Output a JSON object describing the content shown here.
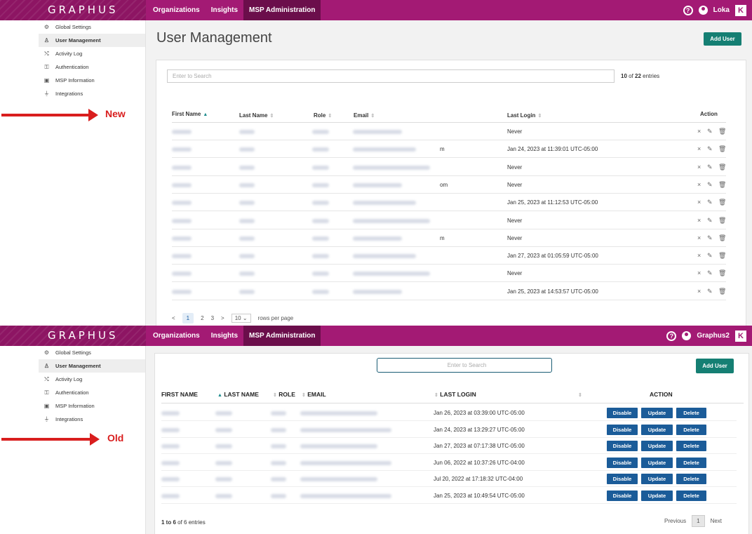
{
  "new": {
    "nav": [
      "Organizations",
      "Insights",
      "MSP Administration"
    ],
    "user_name": "Loka",
    "sidebar": [
      {
        "label": "Global Settings",
        "icon": "gear-icon",
        "glyph": "⚙"
      },
      {
        "label": "User Management",
        "icon": "user-icon",
        "glyph": "♙"
      },
      {
        "label": "Activity Log",
        "icon": "shuffle-icon",
        "glyph": "⤭"
      },
      {
        "label": "Authentication",
        "icon": "user-lock-icon",
        "glyph": "⚿"
      },
      {
        "label": "MSP Information",
        "icon": "id-card-icon",
        "glyph": "▣"
      },
      {
        "label": "Integrations",
        "icon": "plug-icon",
        "glyph": "⏚"
      }
    ],
    "annotation": "New",
    "page_title": "User Management",
    "add_user": "Add User",
    "search_placeholder": "Enter to Search",
    "entries": "10 of 22 entries",
    "columns": [
      "First Name",
      "Last Name",
      "Role",
      "Email",
      "Last Login",
      "Action"
    ],
    "last_logins": [
      "Never",
      "Jan 24, 2023 at 11:39:01 UTC-05:00",
      "Never",
      "Never",
      "Jan 25, 2023 at 11:12:53 UTC-05:00",
      "Never",
      "Never",
      "Jan 27, 2023 at 01:05:59 UTC-05:00",
      "Never",
      "Jan 25, 2023 at 14:53:57 UTC-05:00"
    ],
    "email_visible_suffix": [
      "",
      "m",
      "",
      "om",
      "",
      "",
      "m",
      "",
      "",
      ""
    ],
    "pagination": {
      "pages": [
        "1",
        "2",
        "3"
      ],
      "rows_per_page": "10",
      "rows_label": "rows per page"
    }
  },
  "old": {
    "nav": [
      "Organizations",
      "Insights",
      "MSP Administration"
    ],
    "user_name": "Graphus2",
    "sidebar": [
      {
        "label": "Global Settings",
        "icon": "gear-icon",
        "glyph": "⚙"
      },
      {
        "label": "User Management",
        "icon": "user-icon",
        "glyph": "♙"
      },
      {
        "label": "Activity Log",
        "icon": "shuffle-icon",
        "glyph": "⤭"
      },
      {
        "label": "Authentication",
        "icon": "user-lock-icon",
        "glyph": "⚿"
      },
      {
        "label": "MSP Information",
        "icon": "id-card-icon",
        "glyph": "▣"
      },
      {
        "label": "Integrations",
        "icon": "plug-icon",
        "glyph": "⏚"
      }
    ],
    "annotation": "Old",
    "search_placeholder": "Enter to Search",
    "add_user": "Add User",
    "columns": [
      "FIRST NAME",
      "LAST NAME",
      "ROLE",
      "EMAIL",
      "LAST LOGIN",
      "ACTION"
    ],
    "last_logins": [
      "Jan 26, 2023 at 03:39:00 UTC-05:00",
      "Jan 24, 2023 at 13:29:27 UTC-05:00",
      "Jan 27, 2023 at 07:17:38 UTC-05:00",
      "Jun 06, 2022 at 10:37:26 UTC-04:00",
      "Jul 20, 2022 at 17:18:32 UTC-04:00",
      "Jan 25, 2023 at 10:49:54 UTC-05:00"
    ],
    "buttons": {
      "disable": "Disable",
      "update": "Update",
      "delete": "Delete"
    },
    "footer_entries_bold": "1 to 6",
    "footer_entries_rest": " of 6 entries",
    "pagination": {
      "previous": "Previous",
      "page": "1",
      "next": "Next"
    }
  }
}
